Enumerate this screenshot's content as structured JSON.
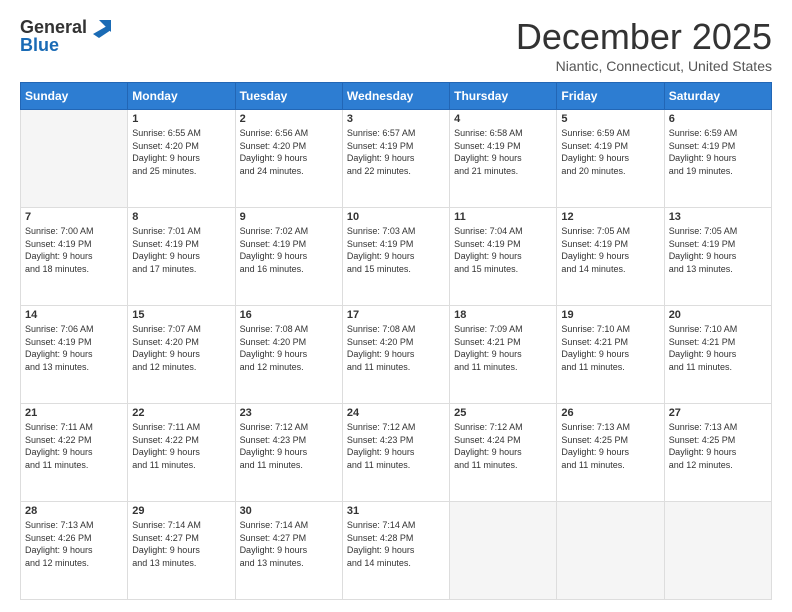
{
  "logo": {
    "general": "General",
    "blue": "Blue"
  },
  "header": {
    "month_title": "December 2025",
    "subtitle": "Niantic, Connecticut, United States"
  },
  "days_of_week": [
    "Sunday",
    "Monday",
    "Tuesday",
    "Wednesday",
    "Thursday",
    "Friday",
    "Saturday"
  ],
  "weeks": [
    [
      {
        "day": null,
        "info": null
      },
      {
        "day": "1",
        "info": "Sunrise: 6:55 AM\nSunset: 4:20 PM\nDaylight: 9 hours\nand 25 minutes."
      },
      {
        "day": "2",
        "info": "Sunrise: 6:56 AM\nSunset: 4:20 PM\nDaylight: 9 hours\nand 24 minutes."
      },
      {
        "day": "3",
        "info": "Sunrise: 6:57 AM\nSunset: 4:19 PM\nDaylight: 9 hours\nand 22 minutes."
      },
      {
        "day": "4",
        "info": "Sunrise: 6:58 AM\nSunset: 4:19 PM\nDaylight: 9 hours\nand 21 minutes."
      },
      {
        "day": "5",
        "info": "Sunrise: 6:59 AM\nSunset: 4:19 PM\nDaylight: 9 hours\nand 20 minutes."
      },
      {
        "day": "6",
        "info": "Sunrise: 6:59 AM\nSunset: 4:19 PM\nDaylight: 9 hours\nand 19 minutes."
      }
    ],
    [
      {
        "day": "7",
        "info": "Sunrise: 7:00 AM\nSunset: 4:19 PM\nDaylight: 9 hours\nand 18 minutes."
      },
      {
        "day": "8",
        "info": "Sunrise: 7:01 AM\nSunset: 4:19 PM\nDaylight: 9 hours\nand 17 minutes."
      },
      {
        "day": "9",
        "info": "Sunrise: 7:02 AM\nSunset: 4:19 PM\nDaylight: 9 hours\nand 16 minutes."
      },
      {
        "day": "10",
        "info": "Sunrise: 7:03 AM\nSunset: 4:19 PM\nDaylight: 9 hours\nand 15 minutes."
      },
      {
        "day": "11",
        "info": "Sunrise: 7:04 AM\nSunset: 4:19 PM\nDaylight: 9 hours\nand 15 minutes."
      },
      {
        "day": "12",
        "info": "Sunrise: 7:05 AM\nSunset: 4:19 PM\nDaylight: 9 hours\nand 14 minutes."
      },
      {
        "day": "13",
        "info": "Sunrise: 7:05 AM\nSunset: 4:19 PM\nDaylight: 9 hours\nand 13 minutes."
      }
    ],
    [
      {
        "day": "14",
        "info": "Sunrise: 7:06 AM\nSunset: 4:19 PM\nDaylight: 9 hours\nand 13 minutes."
      },
      {
        "day": "15",
        "info": "Sunrise: 7:07 AM\nSunset: 4:20 PM\nDaylight: 9 hours\nand 12 minutes."
      },
      {
        "day": "16",
        "info": "Sunrise: 7:08 AM\nSunset: 4:20 PM\nDaylight: 9 hours\nand 12 minutes."
      },
      {
        "day": "17",
        "info": "Sunrise: 7:08 AM\nSunset: 4:20 PM\nDaylight: 9 hours\nand 11 minutes."
      },
      {
        "day": "18",
        "info": "Sunrise: 7:09 AM\nSunset: 4:21 PM\nDaylight: 9 hours\nand 11 minutes."
      },
      {
        "day": "19",
        "info": "Sunrise: 7:10 AM\nSunset: 4:21 PM\nDaylight: 9 hours\nand 11 minutes."
      },
      {
        "day": "20",
        "info": "Sunrise: 7:10 AM\nSunset: 4:21 PM\nDaylight: 9 hours\nand 11 minutes."
      }
    ],
    [
      {
        "day": "21",
        "info": "Sunrise: 7:11 AM\nSunset: 4:22 PM\nDaylight: 9 hours\nand 11 minutes."
      },
      {
        "day": "22",
        "info": "Sunrise: 7:11 AM\nSunset: 4:22 PM\nDaylight: 9 hours\nand 11 minutes."
      },
      {
        "day": "23",
        "info": "Sunrise: 7:12 AM\nSunset: 4:23 PM\nDaylight: 9 hours\nand 11 minutes."
      },
      {
        "day": "24",
        "info": "Sunrise: 7:12 AM\nSunset: 4:23 PM\nDaylight: 9 hours\nand 11 minutes."
      },
      {
        "day": "25",
        "info": "Sunrise: 7:12 AM\nSunset: 4:24 PM\nDaylight: 9 hours\nand 11 minutes."
      },
      {
        "day": "26",
        "info": "Sunrise: 7:13 AM\nSunset: 4:25 PM\nDaylight: 9 hours\nand 11 minutes."
      },
      {
        "day": "27",
        "info": "Sunrise: 7:13 AM\nSunset: 4:25 PM\nDaylight: 9 hours\nand 12 minutes."
      }
    ],
    [
      {
        "day": "28",
        "info": "Sunrise: 7:13 AM\nSunset: 4:26 PM\nDaylight: 9 hours\nand 12 minutes."
      },
      {
        "day": "29",
        "info": "Sunrise: 7:14 AM\nSunset: 4:27 PM\nDaylight: 9 hours\nand 13 minutes."
      },
      {
        "day": "30",
        "info": "Sunrise: 7:14 AM\nSunset: 4:27 PM\nDaylight: 9 hours\nand 13 minutes."
      },
      {
        "day": "31",
        "info": "Sunrise: 7:14 AM\nSunset: 4:28 PM\nDaylight: 9 hours\nand 14 minutes."
      },
      {
        "day": null,
        "info": null
      },
      {
        "day": null,
        "info": null
      },
      {
        "day": null,
        "info": null
      }
    ]
  ]
}
